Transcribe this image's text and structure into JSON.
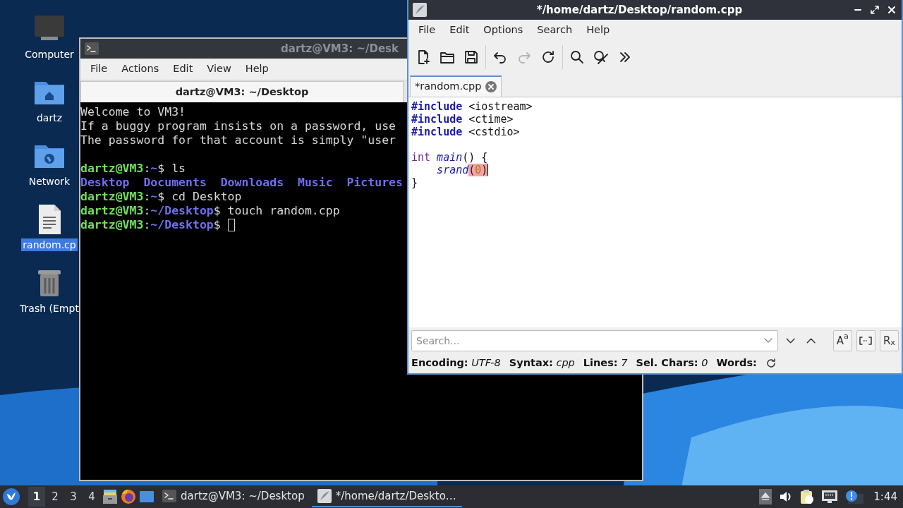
{
  "desktop_icons": [
    {
      "kind": "computer",
      "label": "Computer",
      "selected": false
    },
    {
      "kind": "home-folder",
      "label": "dartz",
      "selected": false
    },
    {
      "kind": "network-folder",
      "label": "Network",
      "selected": false
    },
    {
      "kind": "document",
      "label": "random.cp",
      "selected": true
    },
    {
      "kind": "trash",
      "label": "Trash (Empt",
      "selected": false
    }
  ],
  "terminal": {
    "title": "dartz@VM3: ~/Desk",
    "menu": [
      "File",
      "Actions",
      "Edit",
      "View",
      "Help"
    ],
    "tab_title": "dartz@VM3: ~/Desktop",
    "lines": [
      {
        "segments": [
          {
            "kind": "text",
            "text": "Welcome to VM3!"
          }
        ]
      },
      {
        "segments": [
          {
            "kind": "text",
            "text": "If a buggy program insists on a password, use"
          }
        ]
      },
      {
        "segments": [
          {
            "kind": "text",
            "text": "The password for that account is simply \"user"
          }
        ]
      },
      {
        "blank_line_before": true,
        "segments": [
          {
            "kind": "user",
            "text": "dartz@VM3"
          },
          {
            "kind": "text",
            "text": ":"
          },
          {
            "kind": "path",
            "text": "~"
          },
          {
            "kind": "text",
            "text": "$ ls"
          }
        ]
      },
      {
        "segments": [
          {
            "kind": "dir",
            "text": "Desktop  Documents  Downloads  Music  Pictures"
          }
        ]
      },
      {
        "segments": [
          {
            "kind": "user",
            "text": "dartz@VM3"
          },
          {
            "kind": "text",
            "text": ":"
          },
          {
            "kind": "path",
            "text": "~"
          },
          {
            "kind": "text",
            "text": "$ cd Desktop"
          }
        ]
      },
      {
        "segments": [
          {
            "kind": "user",
            "text": "dartz@VM3"
          },
          {
            "kind": "text",
            "text": ":"
          },
          {
            "kind": "path",
            "text": "~/Desktop"
          },
          {
            "kind": "text",
            "text": "$ touch random.cpp"
          }
        ]
      },
      {
        "segments": [
          {
            "kind": "user",
            "text": "dartz@VM3"
          },
          {
            "kind": "text",
            "text": ":"
          },
          {
            "kind": "path",
            "text": "~/Desktop"
          },
          {
            "kind": "text",
            "text": "$ "
          }
        ],
        "cursor": true
      }
    ]
  },
  "editor": {
    "title": "*/home/dartz/Desktop/random.cpp",
    "menu": [
      "File",
      "Edit",
      "Options",
      "Search",
      "Help"
    ],
    "toolbar": [
      {
        "kind": "new",
        "disabled": false
      },
      {
        "kind": "open",
        "disabled": false
      },
      {
        "kind": "save",
        "disabled": false
      },
      {
        "kind": "separator"
      },
      {
        "kind": "undo",
        "disabled": false
      },
      {
        "kind": "redo",
        "disabled": true
      },
      {
        "kind": "reload",
        "disabled": false
      },
      {
        "kind": "separator"
      },
      {
        "kind": "find",
        "disabled": false
      },
      {
        "kind": "replace",
        "disabled": false
      },
      {
        "kind": "more",
        "disabled": false
      }
    ],
    "tabs": [
      {
        "label": "*random.cpp",
        "selected": true
      }
    ],
    "code_lines": [
      {
        "kind": "code",
        "tokens": [
          {
            "kind": "preprocessor",
            "text": "#include"
          },
          {
            "kind": "plain",
            "text": " <iostream>"
          }
        ]
      },
      {
        "kind": "code",
        "tokens": [
          {
            "kind": "preprocessor",
            "text": "#include"
          },
          {
            "kind": "plain",
            "text": " <ctime>"
          }
        ]
      },
      {
        "kind": "code",
        "tokens": [
          {
            "kind": "preprocessor",
            "text": "#include"
          },
          {
            "kind": "plain",
            "text": " <cstdio>"
          }
        ]
      },
      {
        "kind": "blank"
      },
      {
        "kind": "code",
        "tokens": [
          {
            "kind": "type",
            "text": "int"
          },
          {
            "kind": "function",
            "text": " main"
          },
          {
            "kind": "plain",
            "text": "() {"
          }
        ]
      },
      {
        "kind": "code",
        "tokens": [
          {
            "kind": "function",
            "text": "    srand"
          },
          {
            "kind": "bracket-match",
            "text": "("
          },
          {
            "kind": "number",
            "text": "0"
          },
          {
            "kind": "bracket-match",
            "text": ")",
            "cursor": true
          }
        ]
      },
      {
        "kind": "code",
        "tokens": [
          {
            "kind": "plain",
            "text": "}"
          }
        ]
      }
    ],
    "search": {
      "placeholder": "Search..."
    },
    "search_toggles": [
      {
        "kind": "text",
        "label": "A$^{a}$"
      },
      {
        "kind": "whole-word"
      },
      {
        "kind": "text",
        "label": "R$_{x}$"
      }
    ],
    "status_bar": [
      {
        "label": "Encoding:",
        "value": "UTF-8"
      },
      {
        "label": "Syntax:",
        "value": "cpp"
      },
      {
        "label": "Lines:",
        "value": "7"
      },
      {
        "label": "Sel. Chars:",
        "value": "0"
      },
      {
        "label": "Words:"
      }
    ]
  },
  "taskbar": {
    "workspaces": [
      {
        "label": "1",
        "selected": true
      },
      {
        "label": "2",
        "selected": false
      },
      {
        "label": "3",
        "selected": false
      },
      {
        "label": "4",
        "selected": false
      }
    ],
    "tasks": [
      {
        "kind": "terminal",
        "label": "dartz@VM3: ~/Desktop",
        "selected": false
      },
      {
        "kind": "editor",
        "label": "*/home/dartz/Deskto…",
        "selected": true
      }
    ],
    "clock": "1:44"
  }
}
